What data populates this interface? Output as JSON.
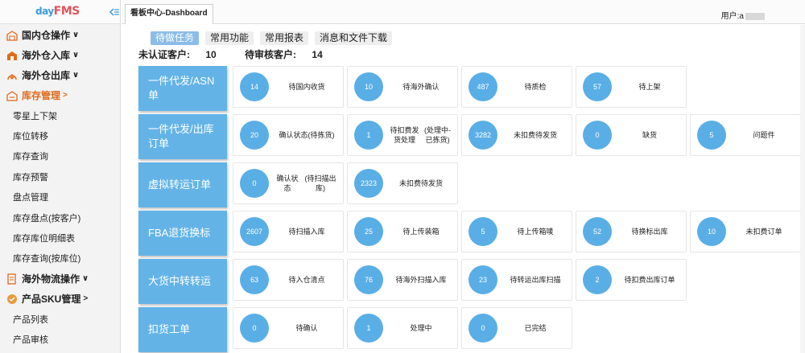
{
  "brand": {
    "logo_day": "day",
    "logo_fms": "FMS"
  },
  "topbar": {
    "tab_label": "看板中心-Dashboard",
    "user_label": "用户:a"
  },
  "sidebar": {
    "groups": [
      {
        "label": "国内仓操作",
        "chev": "∨"
      },
      {
        "label": "海外仓入库",
        "chev": "∨"
      },
      {
        "label": "海外仓出库",
        "chev": "∨"
      },
      {
        "label": "库存管理",
        "chev": ">"
      },
      {
        "label": "海外物流操作",
        "chev": "∨"
      },
      {
        "label": "产品SKU管理",
        "chev": ">"
      }
    ],
    "inventory_items": [
      "零星上下架",
      "库位转移",
      "库存查询",
      "库存预警",
      "盘点管理",
      "库存盘点(按客户)",
      "库存库位明细表",
      "库存查询(按库位)"
    ],
    "sku_items": [
      "产品列表",
      "产品审核"
    ]
  },
  "subtabs": [
    "待做任务",
    "常用功能",
    "常用报表",
    "消息和文件下载"
  ],
  "counts": {
    "unverified_label": "未认证客户:",
    "unverified_value": "10",
    "pending_label": "待审核客户:",
    "pending_value": "14"
  },
  "rows": [
    {
      "label_line1": "一件代发/ASN",
      "label_line2": "单",
      "cards": [
        {
          "value": "14",
          "label": "待国内收货"
        },
        {
          "value": "10",
          "label": "待海外确认"
        },
        {
          "value": "487",
          "label": "待质检"
        },
        {
          "value": "57",
          "label": "待上架"
        }
      ]
    },
    {
      "label_line1": "一件代发/出库",
      "label_line2": "订单",
      "cards": [
        {
          "value": "20",
          "label": "确认状态\n(待拣货)"
        },
        {
          "value": "1",
          "label": "待扣费发货处理\n(处理中-已拣货)"
        },
        {
          "value": "3282",
          "label": "未扣费待发货"
        },
        {
          "value": "0",
          "label": "缺货"
        },
        {
          "value": "5",
          "label": "问题件"
        }
      ]
    },
    {
      "label_line1": "虚拟转运订单",
      "label_line2": "",
      "cards": [
        {
          "value": "0",
          "label": "确认状态\n(待扫描出库)"
        },
        {
          "value": "2323",
          "label": "未扣费待发货"
        }
      ]
    },
    {
      "label_line1": "FBA退货换标",
      "label_line2": "",
      "cards": [
        {
          "value": "2607",
          "label": "待扫描入库"
        },
        {
          "value": "25",
          "label": "待上传装箱"
        },
        {
          "value": "5",
          "label": "待上传箱唛"
        },
        {
          "value": "52",
          "label": "待换标出库"
        },
        {
          "value": "10",
          "label": "未扣费订单"
        }
      ]
    },
    {
      "label_line1": "大货中转转运",
      "label_line2": "",
      "cards": [
        {
          "value": "63",
          "label": "待入仓清点"
        },
        {
          "value": "76",
          "label": "待海外扫描入库"
        },
        {
          "value": "23",
          "label": "待转运出库扫描"
        },
        {
          "value": "2",
          "label": "待扣费出库订单"
        }
      ]
    },
    {
      "label_line1": "扣货工单",
      "label_line2": "",
      "cards": [
        {
          "value": "0",
          "label": "待确认"
        },
        {
          "value": "1",
          "label": "处理中"
        },
        {
          "value": "0",
          "label": "已完结"
        }
      ]
    }
  ],
  "colors": {
    "accent_blue": "#63b3e7",
    "circle_blue": "#5aaee6",
    "active_menu": "#e06a1c",
    "logo_red": "#e4545a"
  },
  "icons": {
    "collapse": "collapse-menu-icon",
    "group_icon": "warehouse-icon"
  }
}
